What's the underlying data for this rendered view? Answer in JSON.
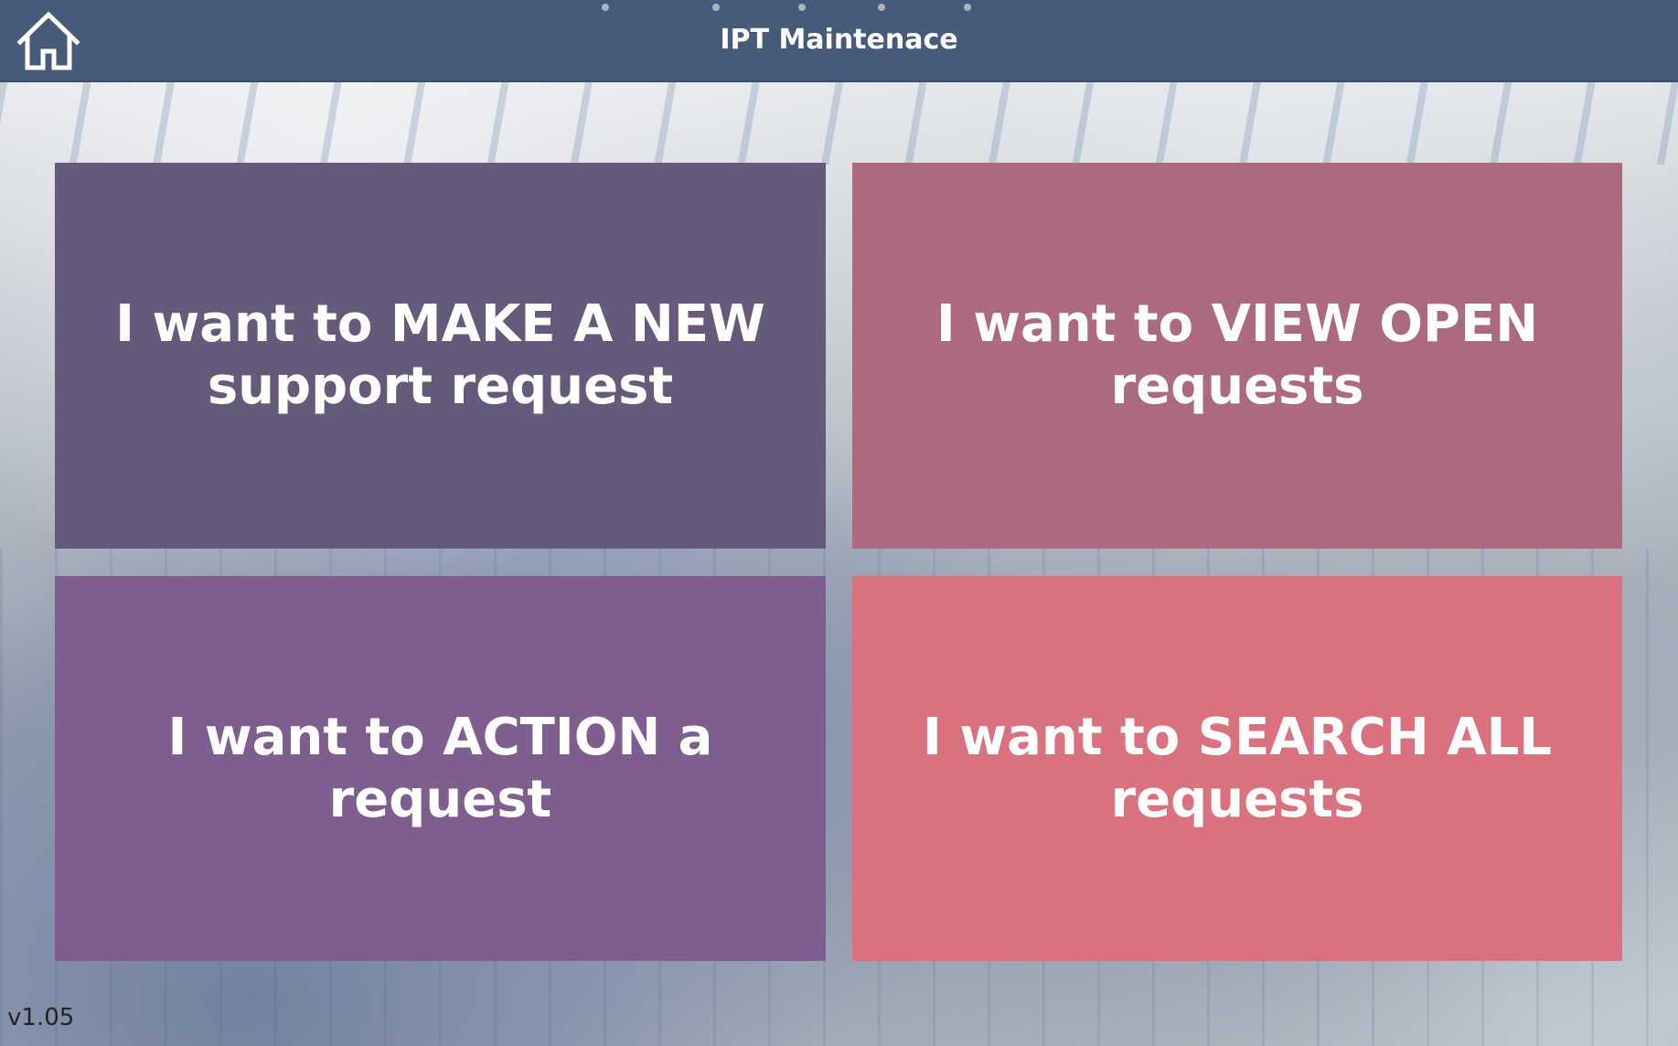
{
  "header": {
    "title": "IPT Maintenace",
    "home_icon": "home-icon",
    "background_color": "#465b7a"
  },
  "tiles": [
    {
      "label": "I want to MAKE A NEW support request",
      "color": "#665a7a"
    },
    {
      "label": "I want to VIEW OPEN requests",
      "color": "#ab6a7e"
    },
    {
      "label": "I want to ACTION a request",
      "color": "#7e5e8e"
    },
    {
      "label": "I want to SEARCH ALL requests",
      "color": "#d9717e"
    }
  ],
  "footer": {
    "version": "v1.05"
  }
}
